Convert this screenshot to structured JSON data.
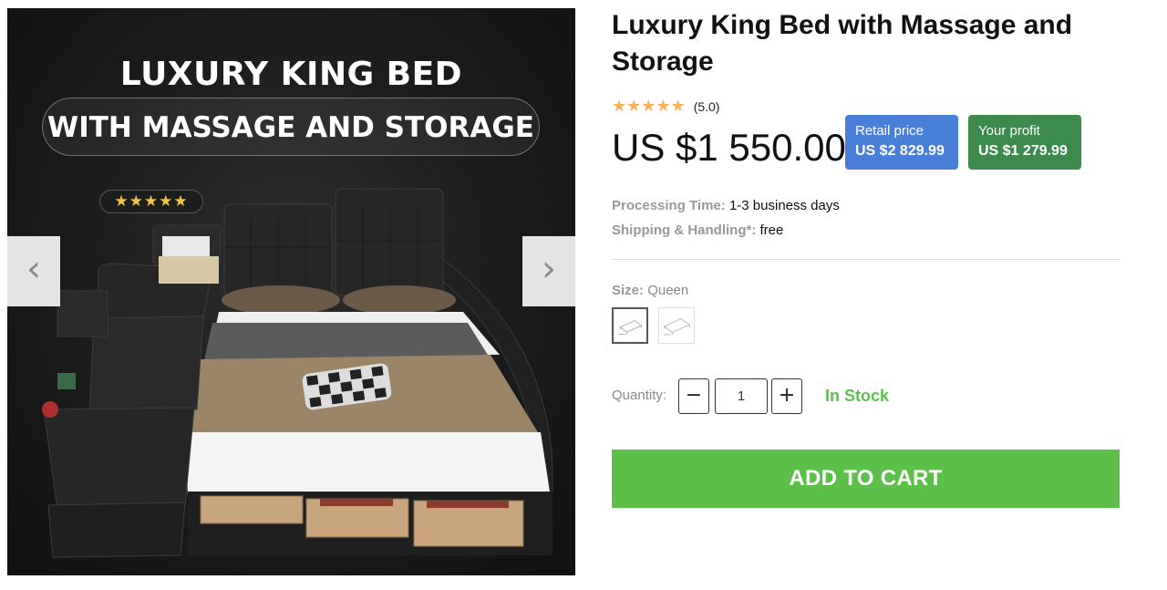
{
  "gallery": {
    "banner_title": "LUXURY KING BED",
    "banner_subtitle": "WITH MASSAGE AND STORAGE",
    "image_stars": "★★★★★",
    "prev_arrow": "‹",
    "next_arrow": "›"
  },
  "product": {
    "title": "Luxury King Bed with Massage and Storage",
    "stars": "★★★★★",
    "rating_text": "(5.0)",
    "rating_value": 5.0,
    "price": "US $1 550.00",
    "retail_label": "Retail price",
    "retail_value": "US $2 829.99",
    "profit_label": "Your profit",
    "profit_value": "US $1 279.99"
  },
  "info": {
    "processing_label": "Processing Time:",
    "processing_value": "1-3 business days",
    "shipping_label": "Shipping & Handling*:",
    "shipping_value": "free"
  },
  "size": {
    "label": "Size:",
    "selected": "Queen"
  },
  "quantity": {
    "label": "Quantity:",
    "value": "1",
    "minus": "−",
    "plus": "+",
    "stock_status": "In Stock"
  },
  "cart": {
    "add_label": "ADD TO CART"
  },
  "colors": {
    "retail_tag": "#4a7fd9",
    "profit_tag": "#3c8b4d",
    "cart_button": "#5cbf4a",
    "stock_text": "#5cbf4f",
    "star_color": "#f5b25a"
  }
}
